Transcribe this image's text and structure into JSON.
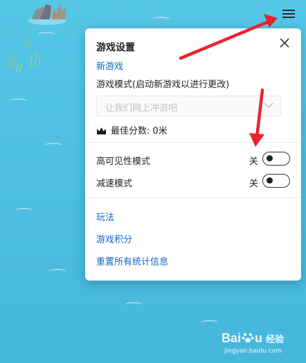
{
  "colors": {
    "background": "#4fc1e4",
    "link": "#1166c9",
    "panel": "#ffffff",
    "arrow": "#e8232e"
  },
  "menu": {
    "icon": "hamburger-menu-icon"
  },
  "settings_panel": {
    "title": "游戏设置",
    "close_icon": "close-icon",
    "new_game_link": "新游戏",
    "game_mode_label": "游戏模式(启动新游戏以进行更改)",
    "game_mode_select": {
      "value": "让我们网上冲浪吧",
      "icon": "chevron-down-icon"
    },
    "best_score": {
      "icon": "crown-icon",
      "text": "最佳分数: 0米"
    },
    "toggles": [
      {
        "label": "高可见性模式",
        "state": "关",
        "on": false
      },
      {
        "label": "减速模式",
        "state": "关",
        "on": false
      }
    ],
    "links": [
      "玩法",
      "游戏积分",
      "重置所有统计信息"
    ]
  },
  "watermark": {
    "brand_left": "Bai",
    "brand_right": "u",
    "brand_cn": "经验",
    "url": "jingyan.baidu.com"
  }
}
